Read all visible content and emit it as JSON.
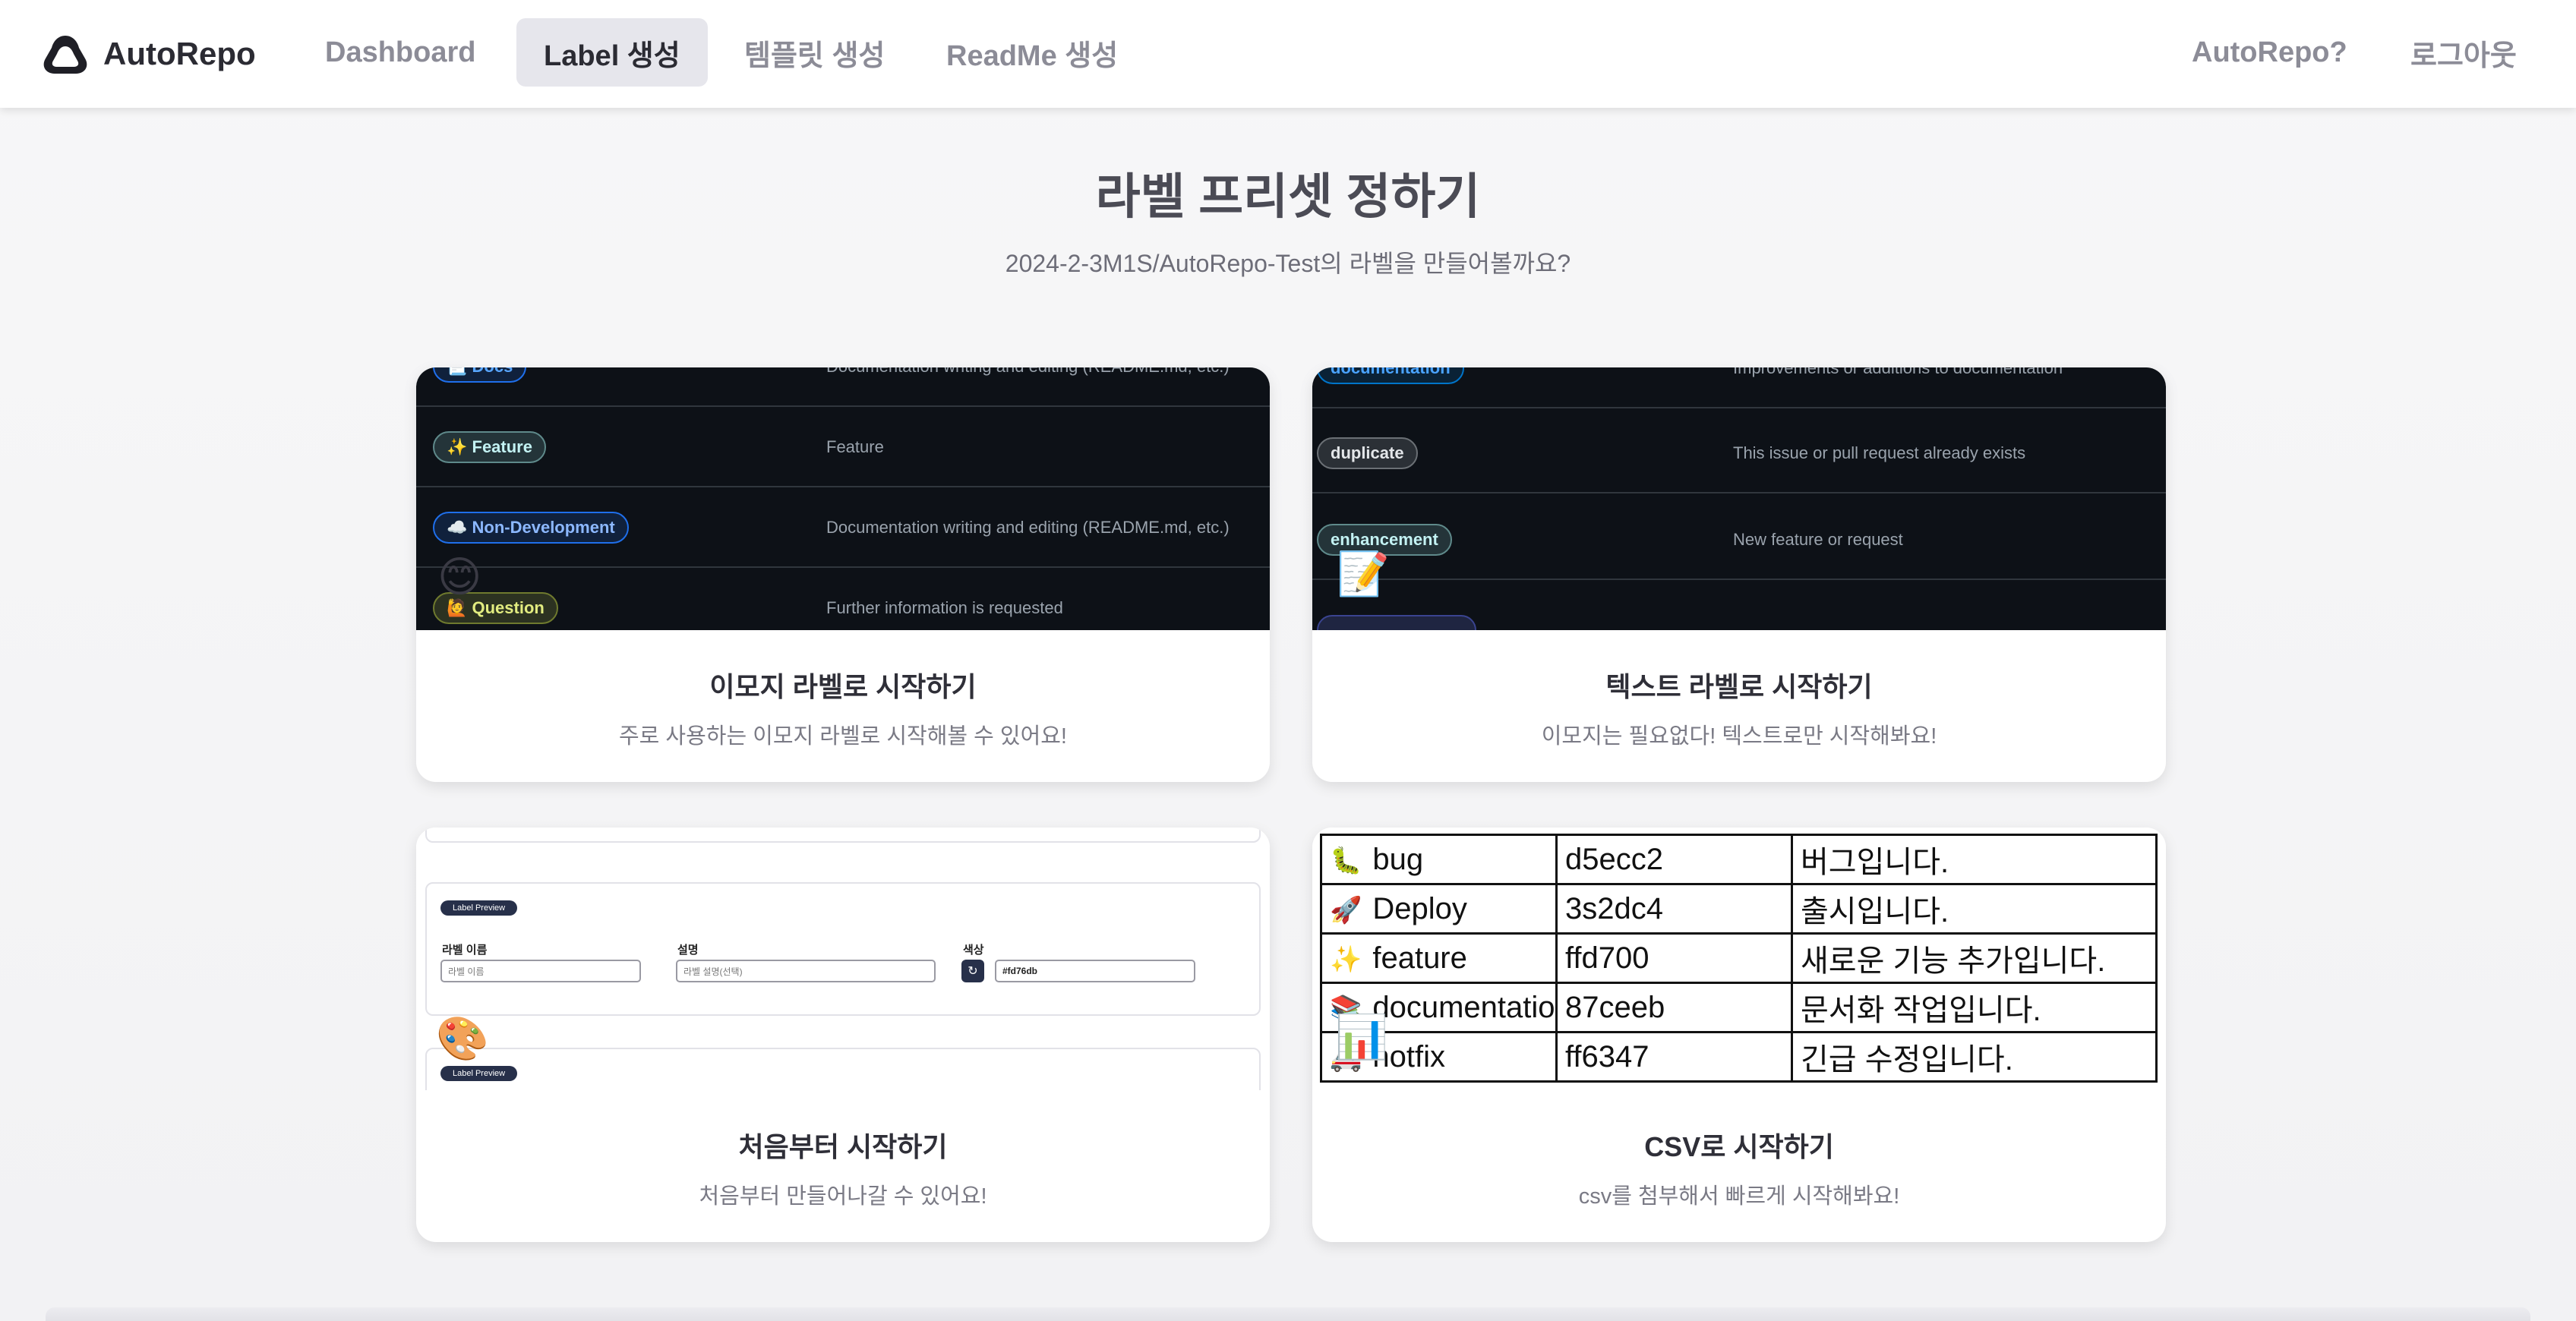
{
  "navbar": {
    "brand": "AutoRepo",
    "items": [
      {
        "label": "Dashboard",
        "active": false
      },
      {
        "label": "Label 생성",
        "active": true
      },
      {
        "label": "템플릿 생성",
        "active": false
      },
      {
        "label": "ReadMe 생성",
        "active": false
      }
    ],
    "right_items": [
      "AutoRepo?",
      "로그아웃"
    ]
  },
  "header": {
    "title": "라벨 프리셋 정하기",
    "subtitle": "2024-2-3M1S/AutoRepo-Test의 라벨을 만들어볼까요?"
  },
  "cards": [
    {
      "title": "이모지 라벨로 시작하기",
      "desc": "주로 사용하는 이모지 라벨로 시작해볼 수 있어요!",
      "icon": "smile-emoji-icon",
      "emoji": "😊",
      "preview_rows": [
        {
          "label": "📃 Docs",
          "desc": "Documentation writing and editing (README.md, etc.)",
          "color": "#1f6feb"
        },
        {
          "label": "✨ Feature",
          "desc": "Feature",
          "color": "#a2eeef"
        },
        {
          "label": "☁️ Non-Development",
          "desc": "Documentation writing and editing (README.md, etc.)",
          "color": "#1f6feb"
        },
        {
          "label": "🙋 Question",
          "desc": "Further information is requested",
          "color": "#d4e157"
        }
      ]
    },
    {
      "title": "텍스트 라벨로 시작하기",
      "desc": "이모지는 필요없다! 텍스트로만 시작해봐요!",
      "icon": "memo-emoji-icon",
      "emoji": "📝",
      "preview_rows": [
        {
          "label": "documentation",
          "desc": "Improvements or additions to documentation",
          "color": "#0075ca"
        },
        {
          "label": "duplicate",
          "desc": "This issue or pull request already exists",
          "color": "#cfd3d7"
        },
        {
          "label": "enhancement",
          "desc": "New feature or request",
          "color": "#a2eeef"
        }
      ]
    },
    {
      "title": "처음부터 시작하기",
      "desc": "처음부터 만들어나갈 수 있어요!",
      "icon": "palette-emoji-icon",
      "emoji": "🎨",
      "form": {
        "pill": "Label Preview",
        "name_label": "라벨 이름",
        "name_placeholder": "라벨 이름",
        "desc_label": "설명",
        "desc_placeholder": "라벨 설명(선택)",
        "color_label": "색상",
        "color_value": "#fd76db"
      }
    },
    {
      "title": "CSV로 시작하기",
      "desc": "csv를 첨부해서 빠르게 시작해봐요!",
      "icon": "bar-chart-emoji-icon",
      "emoji": "📊",
      "csv_rows": [
        {
          "emoji": "🐛",
          "name": "bug",
          "color": "d5ecc2",
          "desc": "버그입니다."
        },
        {
          "emoji": "🚀",
          "name": "Deploy",
          "color": "3s2dc4",
          "desc": "출시입니다."
        },
        {
          "emoji": "✨",
          "name": "feature",
          "color": "ffd700",
          "desc": "새로운 기능 추가입니다."
        },
        {
          "emoji": "📚",
          "name": "documentation",
          "color": "87ceeb",
          "desc": "문서화 작업입니다."
        },
        {
          "emoji": "🚑",
          "name": "hotfix",
          "color": "ff6347",
          "desc": "긴급 수정입니다."
        }
      ]
    }
  ]
}
